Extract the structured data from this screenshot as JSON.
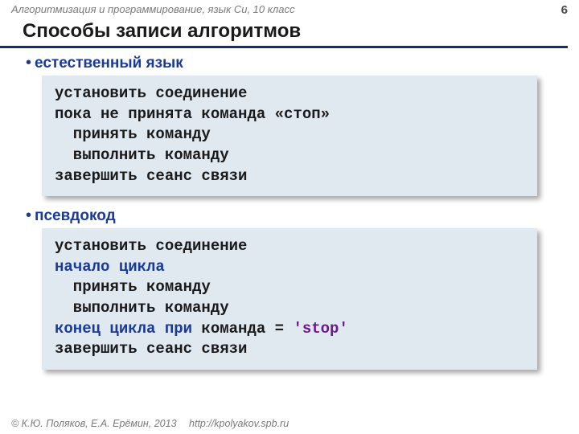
{
  "header": {
    "course": "Алгоритмизация и программирование, язык Си, 10 класс",
    "page": "6"
  },
  "title": "Способы записи алгоритмов",
  "section1": {
    "label": "естественный язык",
    "l1": "установить соединение",
    "l2": "пока не принята команда «стоп»",
    "l3": "  принять команду",
    "l4": "  выполнить команду",
    "l5": "завершить сеанс связи"
  },
  "section2": {
    "label": "псевдокод",
    "l1": "установить соединение",
    "l2a": "начало цикла",
    "l3": "  принять команду",
    "l4": "  выполнить команду",
    "l5a": "конец цикла при",
    "l5b": " команда = ",
    "l5c": "'stop'",
    "l6": "завершить сеанс связи"
  },
  "footer": {
    "copyright": "© К.Ю. Поляков, Е.А. Ерёмин, 2013",
    "url": "http://kpolyakov.spb.ru"
  }
}
